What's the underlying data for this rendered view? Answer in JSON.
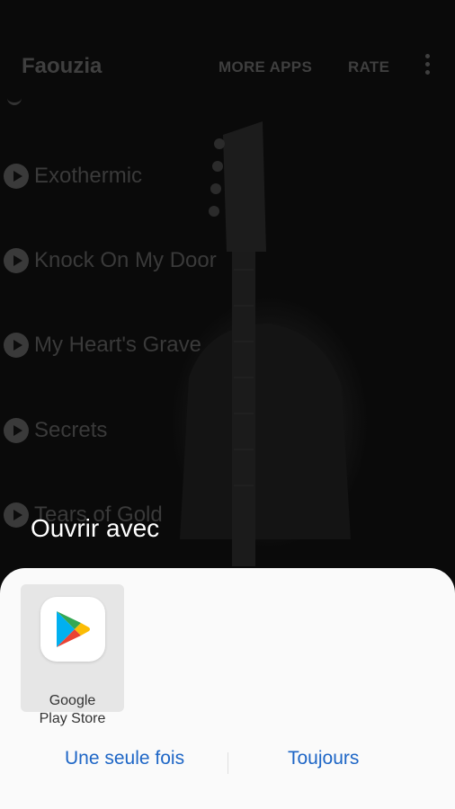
{
  "app_bar": {
    "title": "Faouzia",
    "more_apps_label": "MORE APPS",
    "rate_label": "RATE",
    "overflow_icon": "more-vert-icon"
  },
  "songs": [
    {
      "title": "Exothermic"
    },
    {
      "title": "Knock On My Door"
    },
    {
      "title": "My Heart's Grave"
    },
    {
      "title": "Secrets"
    },
    {
      "title": "Tears of Gold"
    }
  ],
  "dialog": {
    "title": "Ouvrir avec",
    "apps": [
      {
        "name_line1": "Google",
        "name_line2": "Play Store",
        "icon": "google-play-store-icon"
      }
    ],
    "buttons": {
      "once": "Une seule fois",
      "always": "Toujours"
    }
  },
  "colors": {
    "dim_text": "#3f3f3f",
    "dialog_title": "#ffffff",
    "sheet_bg": "#fafafa",
    "button_text": "#1e66c6"
  }
}
